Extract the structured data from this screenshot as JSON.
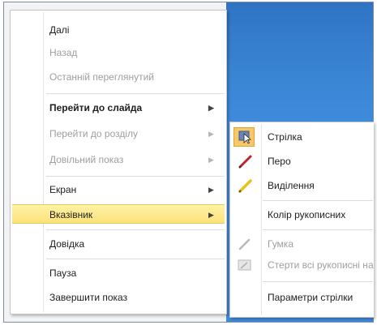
{
  "main_menu": {
    "items": [
      {
        "label": "Далі",
        "disabled": false
      },
      {
        "label": "Назад",
        "disabled": true
      },
      {
        "label": "Останній переглянутий",
        "disabled": true
      },
      {
        "label": "Перейти до слайда",
        "disabled": false,
        "bold": true,
        "submenu": true
      },
      {
        "label": "Перейти до розділу",
        "disabled": true,
        "submenu": true
      },
      {
        "label": "Довільний показ",
        "disabled": true,
        "submenu": true
      },
      {
        "label": "Екран",
        "disabled": false,
        "submenu": true
      },
      {
        "label": "Вказівник",
        "disabled": false,
        "submenu": true,
        "highlighted": true
      },
      {
        "label": "Довідка",
        "disabled": false
      },
      {
        "label": "Пауза",
        "disabled": false
      },
      {
        "label": "Завершити показ",
        "disabled": false
      }
    ],
    "submenu_arrow": "▶"
  },
  "pointer_submenu": {
    "items": [
      {
        "label": "Стрілка",
        "icon": "arrow-pointer-icon",
        "selected": true
      },
      {
        "label": "Перо",
        "icon": "pen-icon"
      },
      {
        "label": "Виділення",
        "icon": "highlighter-icon"
      },
      {
        "label": "Колір рукописних",
        "icon": null
      },
      {
        "label": "Гумка",
        "icon": "eraser-icon",
        "disabled": true
      },
      {
        "label": "Стерти всі рукописні на",
        "icon": "erase-all-icon",
        "disabled": true
      },
      {
        "label": "Параметри стрілки",
        "icon": null
      }
    ]
  },
  "colors": {
    "highlight": "#fbe27a",
    "selected_icon_bg": "#f7c86a",
    "slide_bg": "#3a84d4",
    "pen_red": "#c0242b",
    "highlighter_yellow": "#e8c21a"
  }
}
